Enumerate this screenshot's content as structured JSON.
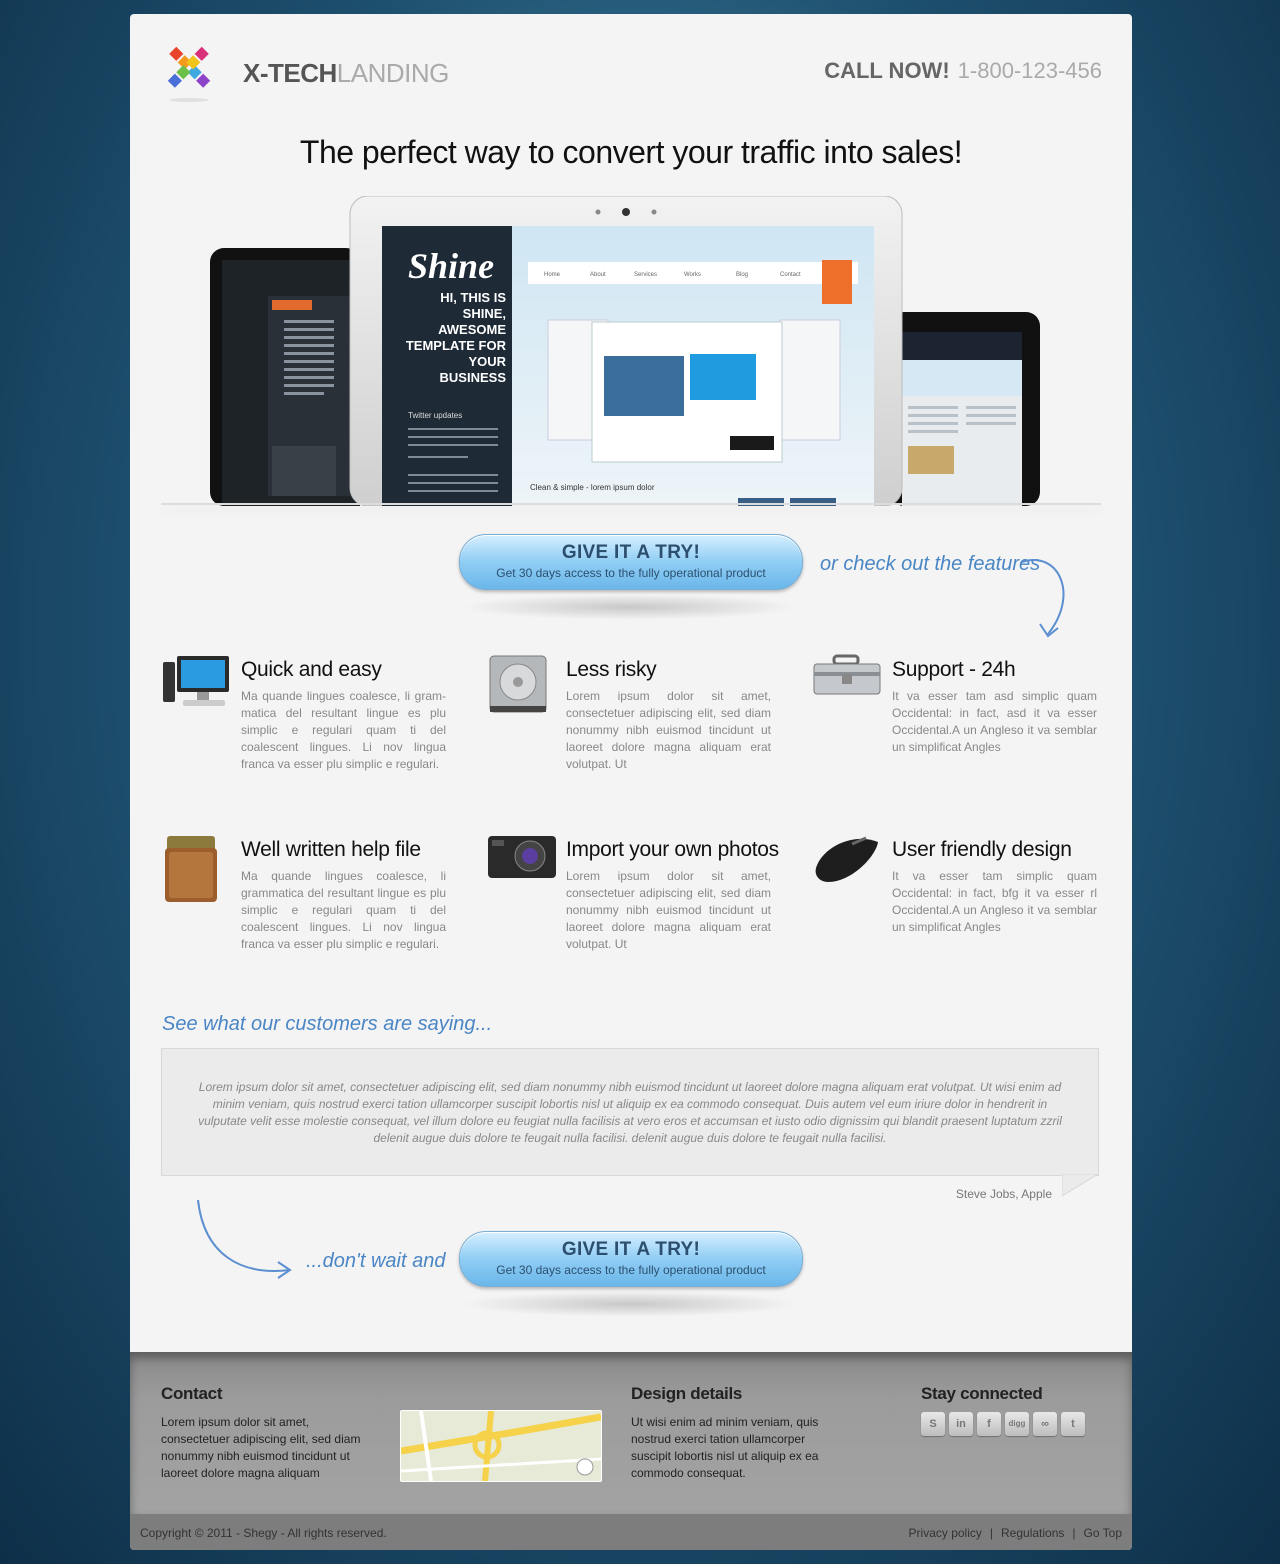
{
  "header": {
    "brand_bold": "X-TECH",
    "brand_light": "LANDING",
    "call_label": "CALL NOW!",
    "phone": "1-800-123-456"
  },
  "headline": "The perfect way to convert your traffic into sales!",
  "hero": {
    "screen_logo": "Shine",
    "screen_text": "HI, THIS IS SHINE, AWESOME TEMPLATE FOR YOUR BUSINESS",
    "nav": [
      "Home",
      "About",
      "Services",
      "Works",
      "Blog",
      "Contact"
    ]
  },
  "cta": {
    "title": "GIVE IT A TRY!",
    "subtitle": "Get 30 days access to the fully operational product"
  },
  "check_features": "or check out the features",
  "features": [
    {
      "title": "Quick and easy",
      "icon": "desktop-computer-icon",
      "text": "Ma quande lingues coalesce, li gram- matica del resultant lingue es plu simplic e regulari quam ti del coalescent lingues. Li nov lingua franca va esser plu simplic e regulari."
    },
    {
      "title": "Less risky",
      "icon": "hard-drive-icon",
      "text": "Lorem ipsum dolor sit amet, consectetuer adipiscing elit, sed diam nonummy nibh euismod tincidunt ut laoreet dolore magna aliquam erat volutpat. Ut"
    },
    {
      "title": "Support - 24h",
      "icon": "toolbox-icon",
      "text": "It va esser tam asd simplic quam Occidental: in fact, asd it va esser Occidental.A un Angleso it va semblar un simplificat Angles"
    },
    {
      "title": "Well written help file",
      "icon": "books-icon",
      "text": "Ma quande lingues coalesce, li grammatica del resultant lingue es plu simplic e regulari quam ti del coalescent lingues. Li nov lingua franca va esser plu simplic e regulari."
    },
    {
      "title": "Import your own photos",
      "icon": "camera-icon",
      "text": "Lorem ipsum dolor sit amet, consectetuer adipiscing elit, sed diam nonummy nibh euismod tincidunt ut laoreet dolore magna aliquam erat volutpat. Ut"
    },
    {
      "title": "User friendly design",
      "icon": "mouse-icon",
      "text": "It va esser tam simplic quam Occidental: in fact, bfg it va esser rl Occidental.A un Angleso it va semblar un simplificat Angles"
    }
  ],
  "testimonials": {
    "heading": "See what our customers are saying...",
    "quote": "Lorem ipsum dolor sit amet, consectetuer adipiscing elit, sed diam nonummy nibh euismod tincidunt ut laoreet dolore magna aliquam erat volutpat. Ut wisi enim ad minim veniam, quis nostrud exerci tation ullamcorper suscipit lobortis nisl ut aliquip ex ea commodo consequat. Duis autem vel eum iriure dolor in hendrerit in vulputate velit esse molestie consequat, vel illum dolore eu feugiat nulla facilisis at vero eros et accumsan et iusto odio dignissim qui blandit praesent luptatum zzril delenit augue duis dolore te feugait nulla facilisi. delenit augue duis dolore te feugait nulla facilisi.",
    "author": "Steve Jobs, Apple"
  },
  "dont_wait": "...don't wait and",
  "footer": {
    "contact_title": "Contact",
    "contact_text": "Lorem ipsum dolor sit amet, consectetuer adipiscing elit, sed diam nonummy nibh euismod tincidunt ut laoreet dolore magna aliquam",
    "design_title": "Design details",
    "design_text": "Ut wisi enim ad minim veniam, quis nostrud exerci tation ullamcorper suscipit lobortis nisl ut aliquip ex ea commodo consequat.",
    "social_title": "Stay connected",
    "social": [
      {
        "name": "skype-icon",
        "glyph": "S"
      },
      {
        "name": "linkedin-icon",
        "glyph": "in"
      },
      {
        "name": "facebook-icon",
        "glyph": "f"
      },
      {
        "name": "digg-icon",
        "glyph": "digg"
      },
      {
        "name": "delicious-icon",
        "glyph": "∞"
      },
      {
        "name": "twitter-icon",
        "glyph": "t"
      }
    ]
  },
  "bottom": {
    "copyright": "Copyright © 2011 - Shegy - All rights reserved.",
    "privacy": "Privacy policy",
    "regulations": "Regulations",
    "go_top": "Go Top"
  }
}
